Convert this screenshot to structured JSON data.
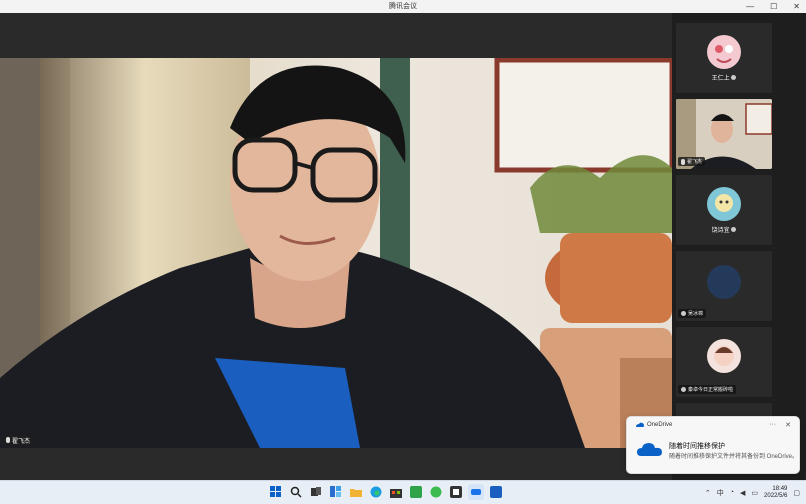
{
  "window": {
    "title": "腾讯会议",
    "minimize": "—",
    "maximize": "☐",
    "close": "✕"
  },
  "main_speaker": {
    "name": "翟飞杰"
  },
  "participants": [
    {
      "name": "王仁上",
      "avatar_color": "#f4c9cf"
    },
    {
      "name": "翟飞杰",
      "avatar_color": "#2a2a2a"
    },
    {
      "name": "饶诗宜",
      "avatar_color": "#7fc7d6"
    },
    {
      "name": "吴冰棉",
      "avatar_color": "#243a5a"
    },
    {
      "name": "秦卓今日正常搬砖啦",
      "avatar_color": "#f3e2de"
    }
  ],
  "toast": {
    "app": "OneDrive",
    "heading": "随着时间推移保护",
    "body": "随着时间推移保护文件并将其备份到 OneDrive。",
    "close": "✕",
    "more": "···"
  },
  "taskbar": {
    "apps": [
      "start",
      "search",
      "task-view",
      "widgets",
      "file-explorer",
      "edge",
      "store",
      "app-green",
      "mail",
      "app-blue",
      "meeting",
      "chrome"
    ],
    "time": "18:49",
    "date": "2022/5/6",
    "lang": "中"
  },
  "colors": {
    "accent": "#1a73e8",
    "onedrive": "#0a62c8",
    "tile_bg": "#2a2a2a"
  }
}
